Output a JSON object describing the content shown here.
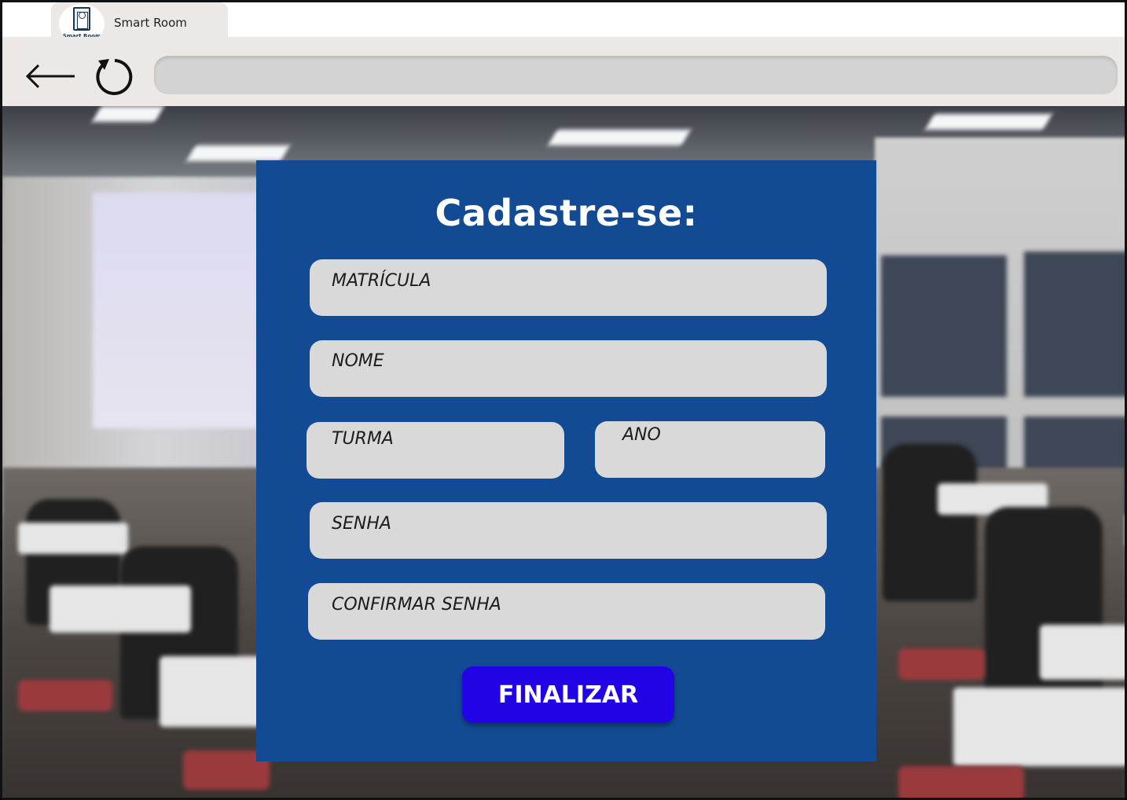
{
  "tab": {
    "title": "Smart Room",
    "logo_text": "Smart Room"
  },
  "toolbar": {
    "back_icon": "arrow-left-icon",
    "reload_icon": "reload-icon",
    "address_value": ""
  },
  "form": {
    "title": "Cadastre-se:",
    "fields": {
      "matricula": "MATRÍCULA",
      "nome": "NOME",
      "turma": "TURMA",
      "ano": "ANO",
      "senha": "SENHA",
      "confirmar_senha": "CONFIRMAR SENHA"
    },
    "submit_label": "FINALIZAR"
  },
  "colors": {
    "panel": "#124b94",
    "button": "#2203e6",
    "field": "#d9d9d9",
    "chrome": "#ece8e6"
  }
}
